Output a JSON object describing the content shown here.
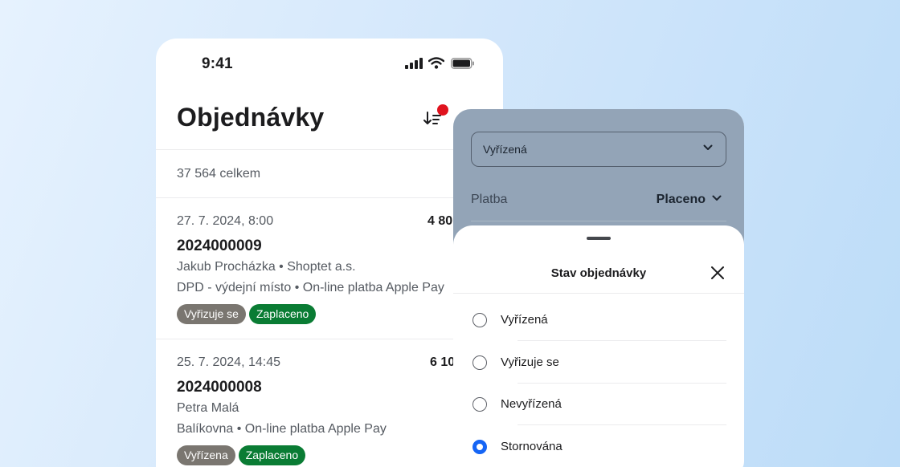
{
  "status_bar": {
    "time": "9:41"
  },
  "orders_screen": {
    "title": "Objednávky",
    "total": "37 564 celkem",
    "orders": [
      {
        "date": "27. 7. 2024, 8:00",
        "amount": "4 80",
        "number": "2024000009",
        "customer": "Jakub Procházka • Shoptet a.s.",
        "shipping_payment": "DPD - výdejní místo • On-line platba Apple Pay",
        "badges": [
          "Vyřizuje se",
          "Zaplaceno"
        ]
      },
      {
        "date": "25. 7. 2024, 14:45",
        "amount": "6 10",
        "number": "2024000008",
        "customer": "Petra Malá",
        "shipping_payment": "Balíkovna • On-line platba Apple Pay",
        "badges": [
          "Vyřízena",
          "Zaplaceno"
        ]
      }
    ]
  },
  "filter_panel": {
    "state_select_value": "Vyřízená",
    "payment_label": "Platba",
    "payment_value": "Placeno"
  },
  "sheet": {
    "title": "Stav objednávky",
    "options": [
      {
        "label": "Vyřízená",
        "selected": false
      },
      {
        "label": "Vyřizuje se",
        "selected": false
      },
      {
        "label": "Nevyřízená",
        "selected": false
      },
      {
        "label": "Stornována",
        "selected": true
      }
    ]
  },
  "colors": {
    "badge_grey": "#7a7670",
    "badge_green": "#0a7c34",
    "radio_selected": "#1565f5",
    "notification_dot": "#e0131e"
  }
}
